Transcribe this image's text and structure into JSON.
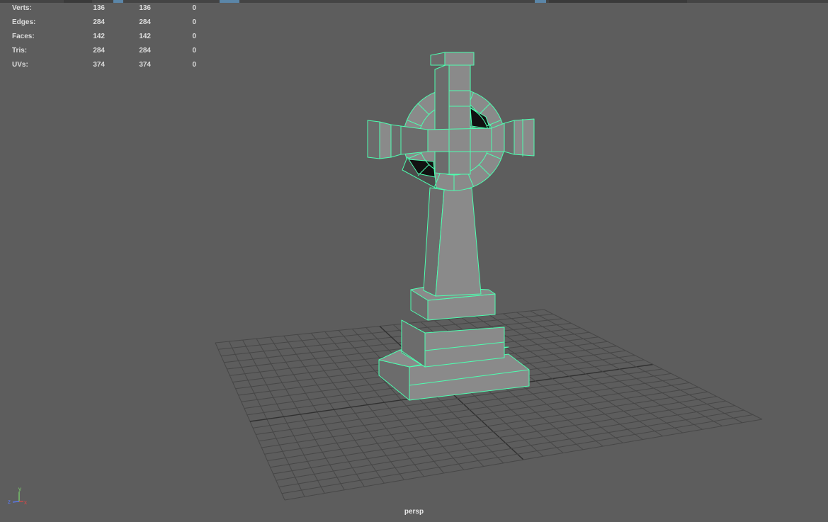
{
  "viewport": {
    "camera": "persp",
    "background": "#5d5d5d",
    "wireframe_color": "#4dffb0"
  },
  "hud": {
    "rows": [
      {
        "label": "Verts:",
        "v1": "136",
        "v2": "136",
        "v3": "0"
      },
      {
        "label": "Edges:",
        "v1": "284",
        "v2": "284",
        "v3": "0"
      },
      {
        "label": "Faces:",
        "v1": "142",
        "v2": "142",
        "v3": "0"
      },
      {
        "label": "Tris:",
        "v1": "284",
        "v2": "284",
        "v3": "0"
      },
      {
        "label": "UVs:",
        "v1": "374",
        "v2": "374",
        "v3": "0"
      }
    ]
  },
  "axis_gizmo": {
    "x": "x",
    "y": "y",
    "z": "z"
  },
  "model": {
    "name": "celtic-cross-gravestone"
  }
}
